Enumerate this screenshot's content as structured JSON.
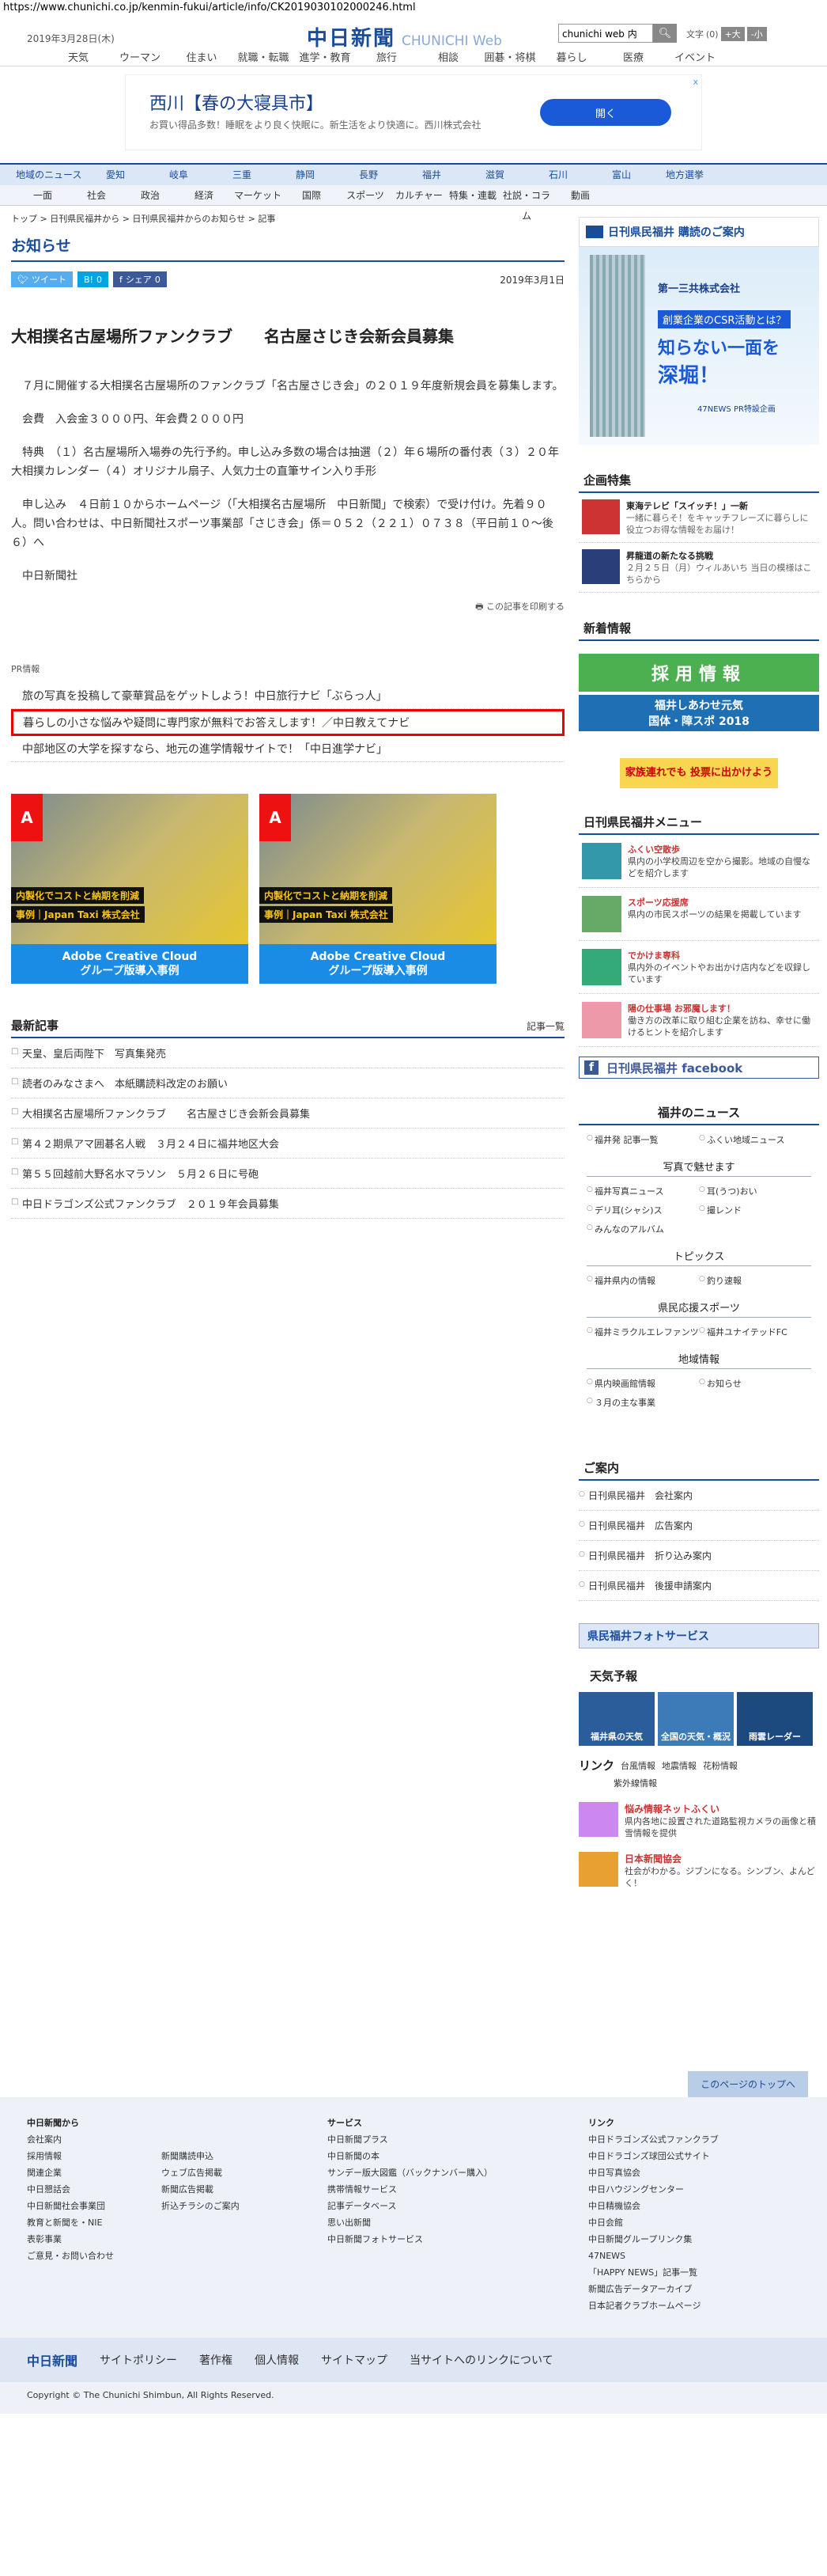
{
  "url": "https://www.chunichi.co.jp/kenmin-fukui/article/info/CK2019030102000246.html",
  "header": {
    "date": "2019年3月28日(木)",
    "logo_jp": "中日新聞",
    "logo_en": "CHUNICHI Web",
    "search_value": "chunichi web 内",
    "search_icon": "search-icon",
    "font_label": "文字",
    "font_reset": "(0)",
    "font_up": "+大",
    "font_down": "-小",
    "nav": [
      "天気",
      "ウーマン",
      "住まい",
      "就職・転職",
      "進学・教育",
      "旅行",
      "相談",
      "囲碁・将棋",
      "暮らし",
      "医療",
      "イベント"
    ]
  },
  "ad": {
    "title": "西川【春の大寝具市】",
    "subtitle": "お買い得品多数！睡眠をより良く快眠に。新生活をより快適に。西川株式会社",
    "button": "開く",
    "close": "x"
  },
  "catbar": [
    "地域のニュース",
    "愛知",
    "岐阜",
    "三重",
    "静岡",
    "長野",
    "福井",
    "滋賀",
    "石川",
    "富山",
    "地方選挙"
  ],
  "subbar": [
    "一面",
    "社会",
    "政治",
    "経済",
    "マーケット",
    "国際",
    "スポーツ",
    "カルチャー",
    "特集・連載",
    "社説・コラム",
    "動画"
  ],
  "breadcrumb": "トップ > 日刊県民福井から > 日刊県民福井からのお知らせ > 記事",
  "page_heading": "お知らせ",
  "share": {
    "tweet": "ツイート",
    "hatena": "B!",
    "hatena_count": "0",
    "facebook": "シェア",
    "facebook_count": "0"
  },
  "article": {
    "date": "2019年3月1日",
    "title": "大相撲名古屋場所ファンクラブ　　名古屋さじき会新会員募集",
    "paragraphs": [
      "　７月に開催する大相撲名古屋場所のファンクラブ「名古屋さじき会」の２０１９年度新規会員を募集します。",
      "　会費　入会金３０００円、年会費２０００円",
      "　特典　（１）名古屋場所入場券の先行予約。申し込み多数の場合は抽選（２）年６場所の番付表（３）２０年大相撲カレンダー（４）オリジナル扇子、人気力士の直筆サイン入り手形",
      "　申し込み　４日前１０からホームページ（「大相撲名古屋場所　中日新聞」で検索）で受け付け。先着９０人。問い合わせは、中日新聞社スポーツ事業部「さじき会」係＝０５２（２２１）０７３８（平日前１０〜後６）へ",
      "　中日新聞社"
    ],
    "print": "この記事を印刷する"
  },
  "pr": {
    "label": "PR情報",
    "items": [
      "旅の写真を投稿して豪華賞品をゲットしよう！中日旅行ナビ「ぶらっ人」",
      "暮らしの小さな悩みや疑問に専門家が無料でお答えします！／中日教えてナビ",
      "中部地区の大学を探すなら、地元の進学情報サイトで！「中日進学ナビ」"
    ]
  },
  "adobe": [
    {
      "logo": "A",
      "cap1": "内製化でコストと納期を削減",
      "cap2": "事例｜Japan Taxi 株式会社",
      "btn1": "Adobe Creative Cloud",
      "btn2": "グループ版導入事例"
    },
    {
      "logo": "A",
      "cap1": "内製化でコストと納期を削減",
      "cap2": "事例｜Japan Taxi 株式会社",
      "btn1": "Adobe Creative Cloud",
      "btn2": "グループ版導入事例"
    }
  ],
  "latest": {
    "heading": "最新記事",
    "list_link": "記事一覧",
    "items": [
      "天皇、皇后両陛下　写真集発売",
      "読者のみなさまへ　本紙購読料改定のお願い",
      "大相撲名古屋場所ファンクラブ　　名古屋さじき会新会員募集",
      "第４２期県アマ囲碁名人戦　３月２４日に福井地区大会",
      "第５５回越前大野名水マラソン　５月２６日に号砲",
      "中日ドラゴンズ公式ファンクラブ　２０１９年会員募集"
    ]
  },
  "side": {
    "subscribe": "日刊県民福井 購読のご案内",
    "bank_ad": {
      "bank": "第一三共株式会社",
      "l1": "創業企業のCSR活動とは？",
      "l2": "知らない一面を",
      "l3": "深堀！",
      "news": "47NEWS PR特設企画"
    },
    "feature_heading": "企画特集",
    "features": [
      {
        "t": "東海テレビ「スイッチ！」一新",
        "d": "一緒に暮らそ！をキャッチフレーズに暮らしに役立つお得な情報をお届け！"
      },
      {
        "t": "昇龍道の新たなる挑戦",
        "d": "２月２５日（月）ウィルあいち 当日の模様はこちらから"
      }
    ],
    "news_heading": "新着情報",
    "banner1": "採用情報",
    "banner2a": "福井しあわせ元気",
    "banner2b": "国体・障スポ 2018",
    "family": "家族連れでも 投票に出かけよう",
    "menu_heading": "日刊県民福井メニュー",
    "menu": [
      {
        "t": "ふくい空散歩",
        "d": "県内の小学校周辺を空から撮影。地域の自慢などを紹介します"
      },
      {
        "t": "スポーツ応援席",
        "d": "県内の市民スポーツの結果を掲載しています"
      },
      {
        "t": "でかけま専科",
        "d": "県内外のイベントやお出かけ店内などを収録しています"
      },
      {
        "t": "陽の仕事場 お邪魔します！",
        "d": "働き方の改革に取り組む企業を訪ね、幸せに働けるヒントを紹介します"
      }
    ],
    "facebook": "日刊県民福井 facebook",
    "fukui_heading": "福井のニュース",
    "fukui_links": [
      "福井発 記事一覧",
      "ふくい地域ニュース"
    ],
    "photos_heading": "写真で魅せます",
    "photo_links": [
      "福井写真ニュース",
      "耳(うつ)おい",
      "デリ耳(シャシ)ス",
      "撮レンド",
      "みんなのアルバム"
    ],
    "topics_heading": "トピックス",
    "topic_links": [
      "福井県内の情報",
      "釣り速報"
    ],
    "sports_heading": "県民応援スポーツ",
    "sports_links": [
      "福井ミラクルエレファンツ",
      "福井ユナイテッドFC"
    ],
    "region_heading": "地域情報",
    "region_links": [
      "県内映画館情報",
      "お知らせ",
      "３月の主な事業"
    ],
    "guide_heading": "ご案内",
    "guide": [
      "日刊県民福井　会社案内",
      "日刊県民福井　広告案内",
      "日刊県民福井　折り込み案内",
      "日刊県民福井　後援申請案内"
    ],
    "photo_service": "県民福井フォトサービス",
    "weather_heading": "天気予報",
    "weather": [
      "福井県の天気",
      "全国の天気・概況",
      "雨雲レーダー"
    ],
    "link_heading": "リンク",
    "link_items": [
      "台風情報",
      "地震情報",
      "花粉情報",
      "紫外線情報"
    ],
    "sidelinks": [
      {
        "t": "悩み情報ネットふくい",
        "d": "県内各地に設置された道路監視カメラの画像と積雪情報を提供"
      },
      {
        "t": "日本新聞協会",
        "d": "社会がわかる。ジブンになる。シンブン、よんどく！"
      }
    ]
  },
  "footer": {
    "totop": "このページのトップへ",
    "col1_head": "中日新聞から",
    "col1": [
      "会社案内",
      "採用情報",
      "関連企業",
      "中日懇話会",
      "中日新聞社会事業団",
      "教育と新聞を・NIE",
      "表彰事業",
      "ご意見・お問い合わせ"
    ],
    "col2": [
      "新聞購読申込",
      "ウェブ広告掲載",
      "新聞広告掲載",
      "折込チラシのご案内"
    ],
    "col3_head": "サービス",
    "col3": [
      "中日新聞プラス",
      "中日新聞の本",
      "サンデー版大図鑑（バックナンバー購入）",
      "携帯情報サービス",
      "記事データベース",
      "思い出新聞",
      "中日新聞フォトサービス"
    ],
    "col4_head": "リンク",
    "col4": [
      "中日ドラゴンズ公式ファンクラブ",
      "中日ドラゴンズ球団公式サイト",
      "中日写真協会",
      "中日ハウジングセンター",
      "中日精機協会",
      "中日会館",
      "中日新聞グループリンク集",
      "47NEWS",
      "「HAPPY NEWS」記事一覧",
      "新聞広告データアーカイブ",
      "日本記者クラブホームページ"
    ],
    "bottom_logo": "中日新聞",
    "bottom": [
      "サイトポリシー",
      "著作権",
      "個人情報",
      "サイトマップ",
      "当サイトへのリンクについて"
    ],
    "copyright": "Copyright © The Chunichi Shimbun, All Rights Reserved."
  }
}
